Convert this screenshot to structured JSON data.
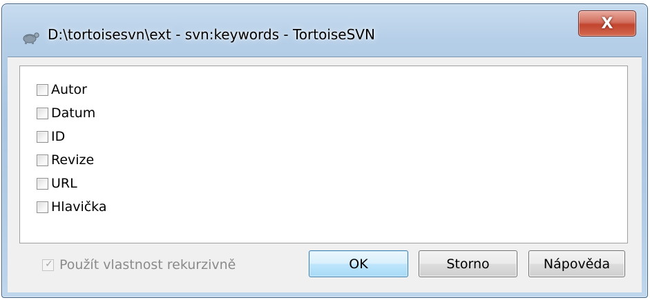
{
  "window": {
    "title": "D:\\tortoisesvn\\ext - svn:keywords - TortoiseSVN",
    "close_glyph": "X",
    "app_icon": "tortoise-icon"
  },
  "keywords": [
    {
      "label": "Autor",
      "checked": false
    },
    {
      "label": "Datum",
      "checked": false
    },
    {
      "label": "ID",
      "checked": false
    },
    {
      "label": "Revize",
      "checked": false
    },
    {
      "label": "URL",
      "checked": false
    },
    {
      "label": "Hlavička",
      "checked": false
    }
  ],
  "recursive": {
    "label": "Použít vlastnost rekurzivně",
    "checked": true,
    "enabled": false
  },
  "buttons": {
    "ok": "OK",
    "cancel": "Storno",
    "help": "Nápověda"
  },
  "colors": {
    "close_red": "#c2442e",
    "default_button": "#3c7fb1",
    "frame": "#a9c5e2"
  }
}
